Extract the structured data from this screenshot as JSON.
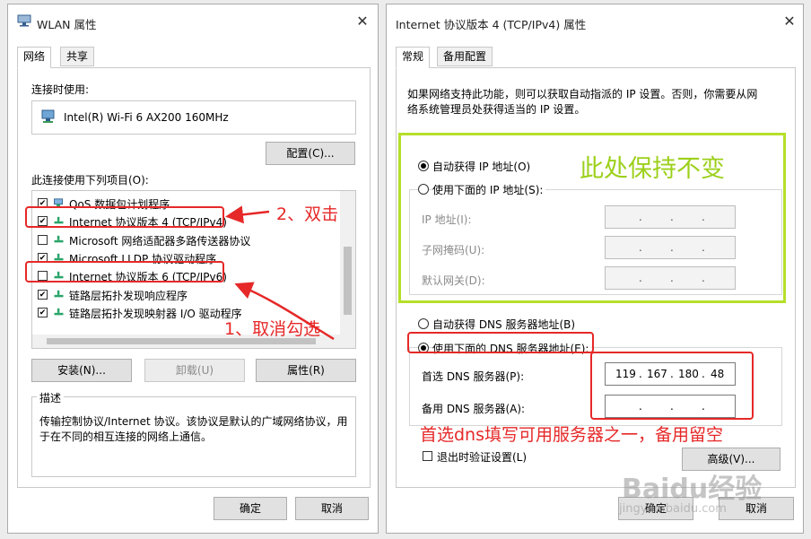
{
  "left_window": {
    "title": "WLAN 属性",
    "tabs": [
      "网络",
      "共享"
    ],
    "connect_using_label": "连接时使用:",
    "adapter": "Intel(R) Wi-Fi 6 AX200 160MHz",
    "configure_button": "配置(C)...",
    "items_label": "此连接使用下列项目(O):",
    "items": [
      {
        "label": "QoS 数据包计划程序",
        "checked": true
      },
      {
        "label": "Internet 协议版本 4 (TCP/IPv4)",
        "checked": true
      },
      {
        "label": "Microsoft 网络适配器多路传送器协议",
        "checked": false
      },
      {
        "label": "Microsoft LLDP 协议驱动程序",
        "checked": true
      },
      {
        "label": "Internet 协议版本 6 (TCP/IPv6)",
        "checked": false
      },
      {
        "label": "链路层拓扑发现响应程序",
        "checked": true
      },
      {
        "label": "链路层拓扑发现映射器 I/O 驱动程序",
        "checked": true
      }
    ],
    "install_button": "安装(N)...",
    "uninstall_button": "卸载(U)",
    "properties_button": "属性(R)",
    "description_label": "描述",
    "description_text_1": "传输控制协议/Internet 协议。该协议是默认的广域网络协议，用",
    "description_text_2": "于在不同的相互连接的网络上通信。",
    "ok_button": "确定",
    "cancel_button": "取消"
  },
  "right_window": {
    "title": "Internet 协议版本 4 (TCP/IPv4) 属性",
    "tabs": [
      "常规",
      "备用配置"
    ],
    "intro_1": "如果网络支持此功能，则可以获取自动指派的 IP 设置。否则，你需要从网",
    "intro_2": "络系统管理员处获得适当的 IP 设置。",
    "auto_ip": "自动获得 IP 地址(O)",
    "manual_ip": "使用下面的 IP 地址(S):",
    "ip_label": "IP 地址(I):",
    "mask_label": "子网掩码(U):",
    "gateway_label": "默认网关(D):",
    "auto_dns": "自动获得 DNS 服务器地址(B)",
    "manual_dns": "使用下面的 DNS 服务器地址(E):",
    "preferred_dns_label": "首选 DNS 服务器(P):",
    "alternate_dns_label": "备用 DNS 服务器(A):",
    "preferred_dns": [
      "119",
      "167",
      "180",
      "48"
    ],
    "dot": ".",
    "validate_label": "退出时验证设置(L)",
    "advanced_button": "高级(V)...",
    "ok_button": "确定",
    "cancel_button": "取消"
  },
  "annotations": {
    "step2": "2、双击",
    "step1": "1、取消勾选",
    "keep": "此处保持不变",
    "dns_note": "首选dns填写可用服务器之一，备用留空"
  },
  "watermark": {
    "brand": "Baidu经验",
    "url": "jingyan.baidu.com"
  },
  "colors": {
    "annotation_red": "#e62828",
    "annotation_green": "#9cd01a",
    "net_icon": "#2aa56a"
  }
}
